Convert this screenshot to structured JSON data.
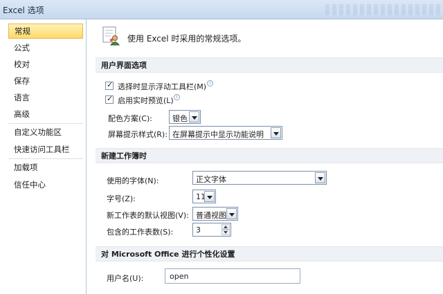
{
  "window": {
    "title": "Excel 选项"
  },
  "sidebar": {
    "items": [
      {
        "label": "常规",
        "selected": true
      },
      {
        "label": "公式"
      },
      {
        "label": "校对"
      },
      {
        "label": "保存"
      },
      {
        "label": "语言"
      },
      {
        "label": "高级"
      },
      {
        "label": "自定义功能区"
      },
      {
        "label": "快速访问工具栏"
      },
      {
        "label": "加载项"
      },
      {
        "label": "信任中心"
      }
    ]
  },
  "intro": {
    "text": "使用 Excel 时采用的常规选项。",
    "icon": "general-options-icon"
  },
  "ui_section": {
    "header": "用户界面选项",
    "mini_toolbar": {
      "label": "选择时显示浮动工具栏(M)",
      "checked": true
    },
    "live_preview": {
      "label": "启用实时预览(L)",
      "checked": true
    },
    "color_scheme": {
      "label": "配色方案(C):",
      "value": "银色"
    },
    "screentip_style": {
      "label": "屏幕提示样式(R):",
      "value": "在屏幕提示中显示功能说明"
    }
  },
  "new_workbook_section": {
    "header": "新建工作簿时",
    "font": {
      "label": "使用的字体(N):",
      "value": "正文字体"
    },
    "font_size": {
      "label": "字号(Z):",
      "value": "11"
    },
    "default_view": {
      "label": "新工作表的默认视图(V):",
      "value": "普通视图"
    },
    "sheet_count": {
      "label": "包含的工作表数(S):",
      "value": "3"
    }
  },
  "personalize_section": {
    "header": "对 Microsoft Office 进行个性化设置",
    "username": {
      "label": "用户名(U):",
      "value": "open"
    }
  },
  "colors": {
    "selected_nav_bg": "#ffd86b",
    "section_header_bg": "#eef1f5",
    "titlebar_bg": "#c7d9ee"
  }
}
